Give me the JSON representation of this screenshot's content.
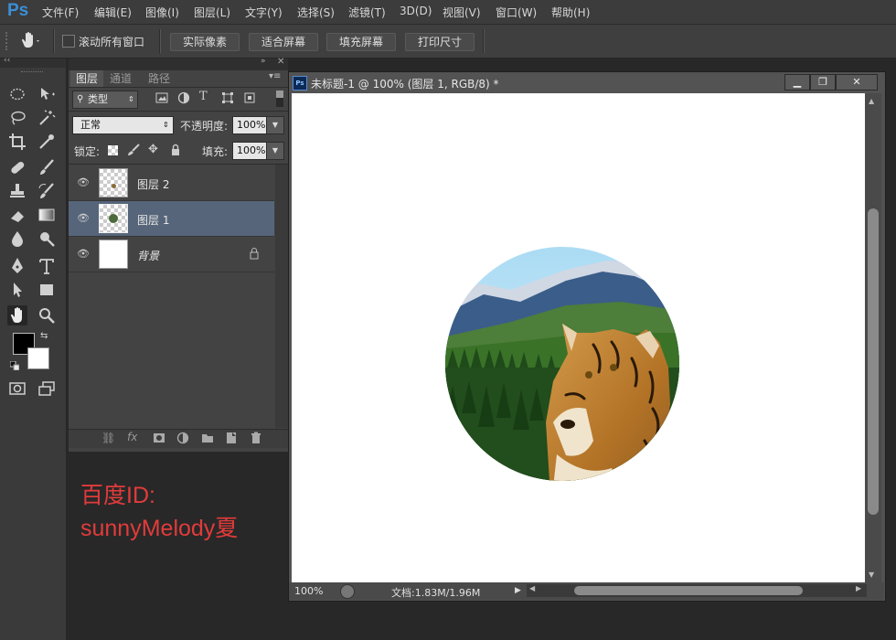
{
  "app": {
    "logo": "Ps"
  },
  "menu": [
    {
      "label": "文件(F)"
    },
    {
      "label": "编辑(E)"
    },
    {
      "label": "图像(I)"
    },
    {
      "label": "图层(L)"
    },
    {
      "label": "文字(Y)"
    },
    {
      "label": "选择(S)"
    },
    {
      "label": "滤镜(T)"
    },
    {
      "label": "3D(D)"
    },
    {
      "label": "视图(V)"
    },
    {
      "label": "窗口(W)"
    },
    {
      "label": "帮助(H)"
    }
  ],
  "options": {
    "scroll_all": "滚动所有窗口",
    "btn_actual": "实际像素",
    "btn_fit": "适合屏幕",
    "btn_fill": "填充屏幕",
    "btn_print": "打印尺寸"
  },
  "panel": {
    "tabs": [
      "图层",
      "通道",
      "路径"
    ],
    "filter_kind": "类型",
    "blend_mode": "正常",
    "opacity_label": "不透明度:",
    "opacity_value": "100%",
    "lock_label": "锁定:",
    "fill_label": "填充:",
    "fill_value": "100%",
    "layers": [
      {
        "name": "图层 2",
        "selected": false
      },
      {
        "name": "图层 1",
        "selected": true
      },
      {
        "name": "背景",
        "selected": false,
        "locked": true
      }
    ],
    "footer_fx": "fx"
  },
  "watermark_text": {
    "line1": "百度ID:",
    "line2": "sunnyMelody夏"
  },
  "document": {
    "title": "未标题-1 @ 100% (图层 1, RGB/8) *",
    "zoom": "100%",
    "doc_info": "文档:1.83M/1.96M"
  },
  "colors": {
    "accent": "#3a8fd8",
    "annotation": "#e23b3b",
    "selected_layer": "#56657a"
  }
}
